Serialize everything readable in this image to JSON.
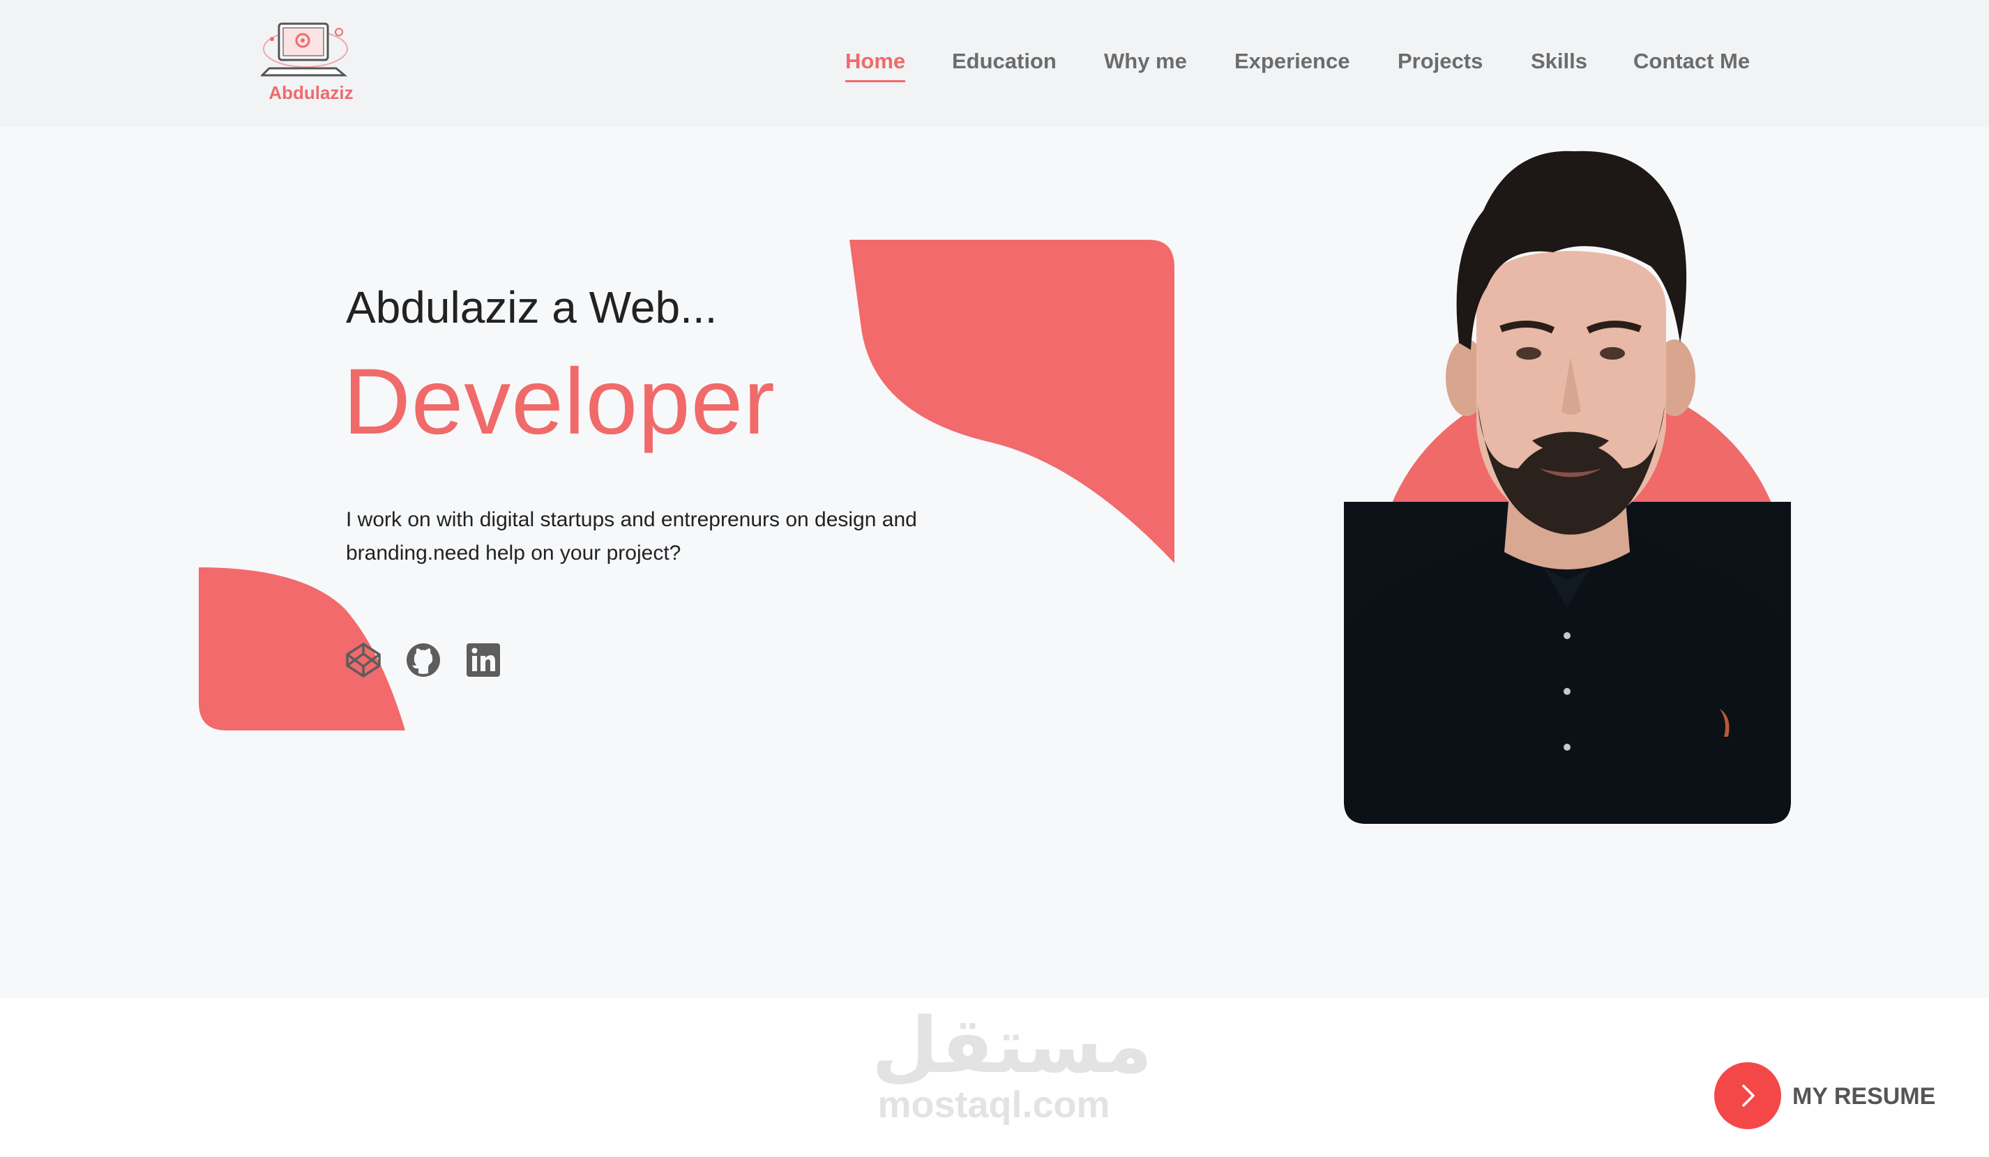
{
  "brand": {
    "name": "Abdulaziz",
    "accent": "#f06a6a"
  },
  "nav": {
    "items": [
      {
        "label": "Home",
        "active": true
      },
      {
        "label": "Education",
        "active": false
      },
      {
        "label": "Why me",
        "active": false
      },
      {
        "label": "Experience",
        "active": false
      },
      {
        "label": "Projects",
        "active": false
      },
      {
        "label": "Skills",
        "active": false
      },
      {
        "label": "Contact Me",
        "active": false
      }
    ]
  },
  "hero": {
    "headline": "Abdulaziz a Web...",
    "role": "Developer",
    "description": "I work on with digital startups and entreprenurs on design and branding.need help on your project?",
    "socials": [
      {
        "icon": "codepen-icon"
      },
      {
        "icon": "github-icon"
      },
      {
        "icon": "linkedin-icon"
      }
    ]
  },
  "watermark": {
    "arabic": "مستقل",
    "latin": "mostaql.com"
  },
  "resume": {
    "label": "MY RESUME",
    "icon": "chevron-right-icon",
    "color": "#f44848"
  }
}
